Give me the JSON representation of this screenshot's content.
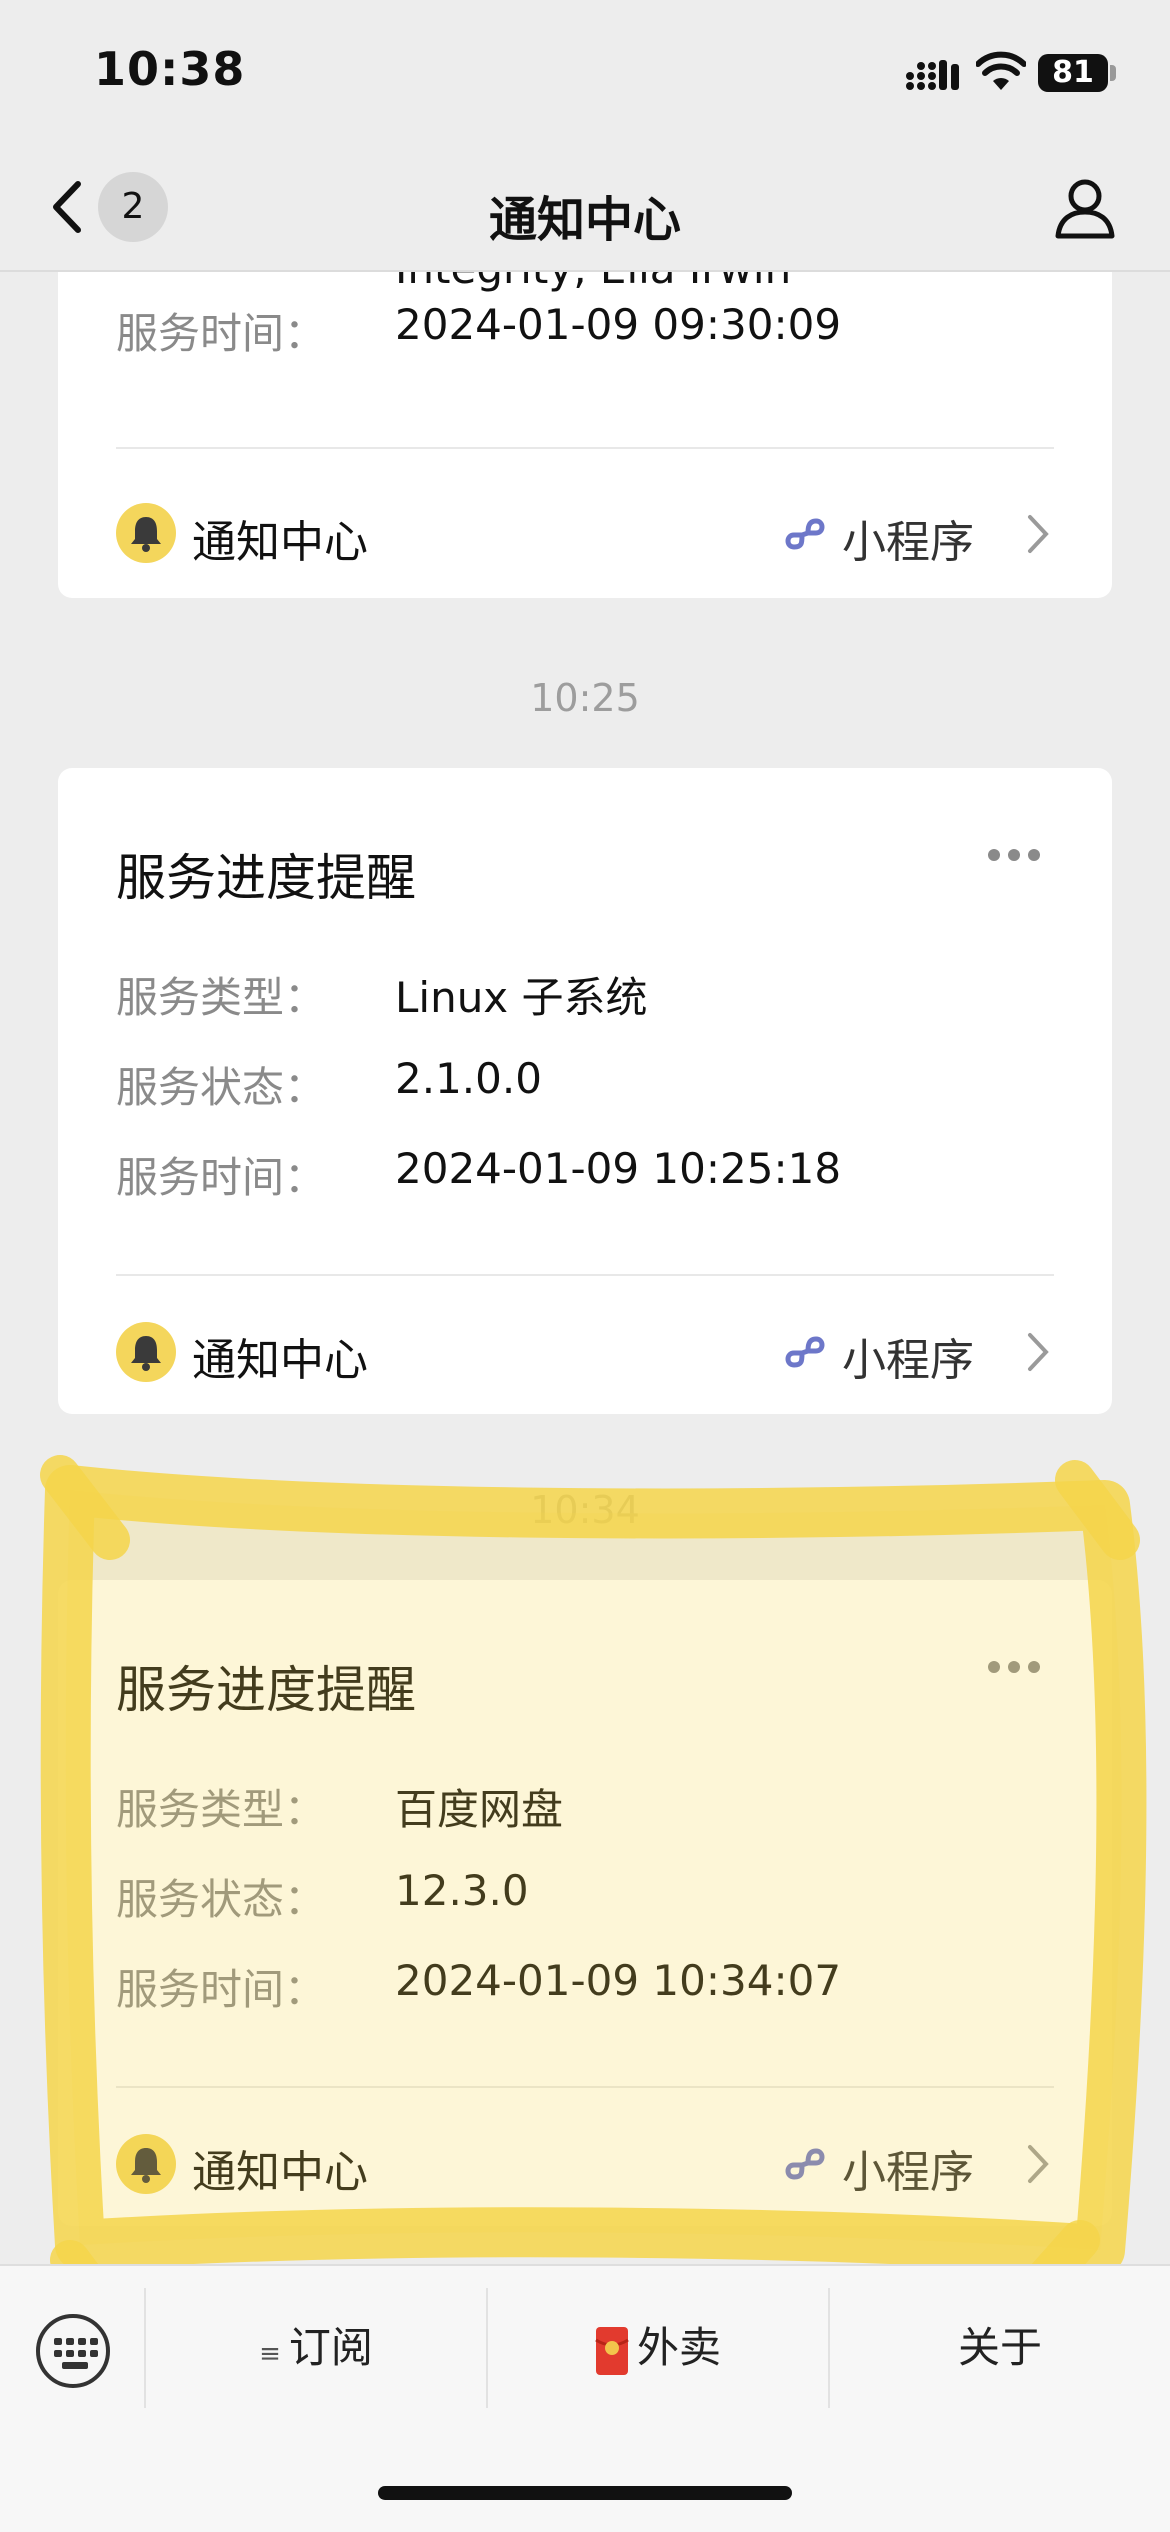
{
  "status_bar": {
    "time": "10:38",
    "battery": "81"
  },
  "nav": {
    "back_count": "2",
    "title": "通知中心"
  },
  "cards": [
    {
      "partial_text": "Integrity, Ella Irwin",
      "time_label": "服务时间：",
      "time_value": "2024-01-09 09:30:09",
      "source": "通知中心",
      "mini_program": "小程序"
    },
    {
      "timestamp": "10:25",
      "title": "服务进度提醒",
      "type_label": "服务类型：",
      "type_value": "Linux 子系统",
      "status_label": "服务状态：",
      "status_value": "2.1.0.0",
      "time_label": "服务时间：",
      "time_value": "2024-01-09 10:25:18",
      "source": "通知中心",
      "mini_program": "小程序"
    },
    {
      "timestamp": "10:34",
      "title": "服务进度提醒",
      "type_label": "服务类型：",
      "type_value": "百度网盘",
      "status_label": "服务状态：",
      "status_value": "12.3.0",
      "time_label": "服务时间：",
      "time_value": "2024-01-09 10:34:07",
      "source": "通知中心",
      "mini_program": "小程序"
    }
  ],
  "bottom_menu": {
    "items": [
      {
        "icon": "≡",
        "label": "订阅"
      },
      {
        "icon": "red-envelope-icon",
        "label": "外卖"
      },
      {
        "label": "关于"
      }
    ]
  },
  "colors": {
    "highlight": "#f5d54a",
    "bell": "#f4d65c",
    "link": "#6d77c9"
  }
}
